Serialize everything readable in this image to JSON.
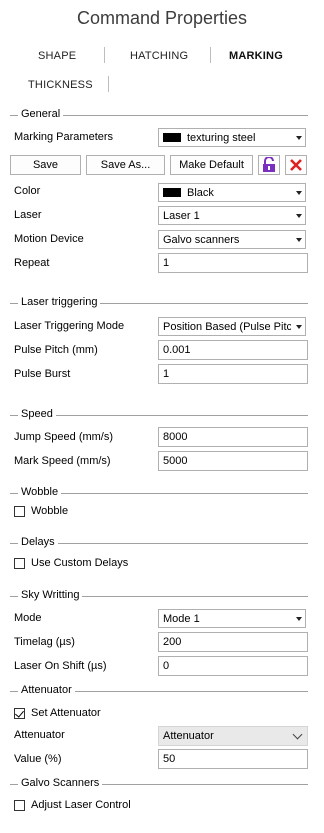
{
  "title": "Command Properties",
  "tabs": [
    "SHAPE",
    "HATCHING",
    "MARKING",
    "THICKNESS"
  ],
  "sections": {
    "general": "General",
    "laser_triggering": "Laser triggering",
    "speed": "Speed",
    "wobble": "Wobble",
    "delays": "Delays",
    "sky_writing": "Sky Writting",
    "attenuator": "Attenuator",
    "galvo": "Galvo Scanners"
  },
  "general": {
    "marking_params_label": "Marking Parameters",
    "marking_params_value": "texturing steel",
    "save": "Save",
    "save_as": "Save As...",
    "make_default": "Make Default",
    "color_label": "Color",
    "color_value": "Black",
    "laser_label": "Laser",
    "laser_value": "Laser 1",
    "motion_label": "Motion Device",
    "motion_value": "Galvo scanners",
    "repeat_label": "Repeat",
    "repeat_value": "1"
  },
  "laser_triggering": {
    "mode_label": "Laser Triggering Mode",
    "mode_value": "Position Based (Pulse Pitch)",
    "pitch_label": "Pulse Pitch (mm)",
    "pitch_value": "0.001",
    "burst_label": "Pulse Burst",
    "burst_value": "1"
  },
  "speed": {
    "jump_label": "Jump Speed (mm/s)",
    "jump_value": "8000",
    "mark_label": "Mark Speed (mm/s)",
    "mark_value": "5000"
  },
  "wobble": {
    "checkbox_label": "Wobble",
    "checked": false
  },
  "delays": {
    "checkbox_label": "Use Custom Delays",
    "checked": false
  },
  "sky_writing": {
    "mode_label": "Mode",
    "mode_value": "Mode 1",
    "timelag_label": "Timelag (µs)",
    "timelag_value": "200",
    "shift_label": "Laser On Shift (µs)",
    "shift_value": "0"
  },
  "attenuator": {
    "checkbox_label": "Set Attenuator",
    "checked": true,
    "label": "Attenuator",
    "value_select": "Attenuator",
    "value_label": "Value (%)",
    "value": "50"
  },
  "galvo": {
    "checkbox_label": "Adjust Laser Control",
    "checked": false
  },
  "colors": {
    "lock": "#7b2fbf",
    "delete": "#e02020"
  },
  "icons": {
    "lock": "unlock-icon",
    "delete": "close-icon"
  }
}
